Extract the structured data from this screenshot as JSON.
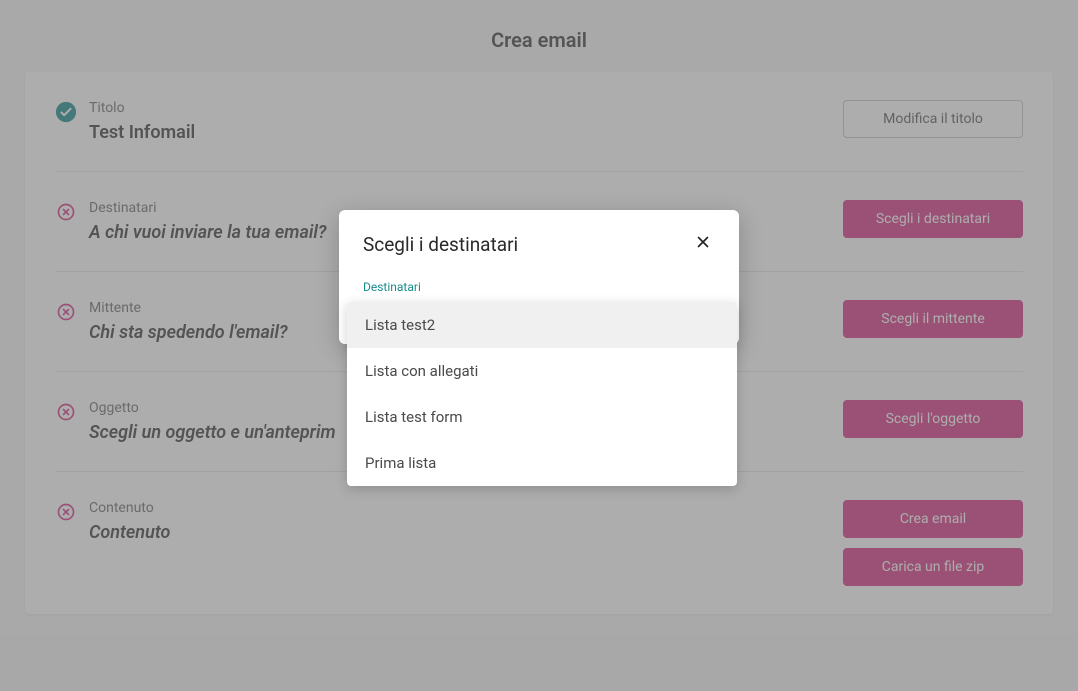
{
  "page": {
    "title": "Crea email"
  },
  "sections": {
    "titolo": {
      "label": "Titolo",
      "value": "Test Infomail",
      "action": "Modifica il titolo",
      "status": "complete"
    },
    "destinatari": {
      "label": "Destinatari",
      "value": "A chi vuoi inviare la tua email?",
      "action": "Scegli i destinatari",
      "status": "incomplete"
    },
    "mittente": {
      "label": "Mittente",
      "value": "Chi sta spedendo l'email?",
      "action": "Scegli il mittente",
      "status": "incomplete"
    },
    "oggetto": {
      "label": "Oggetto",
      "value": "Scegli un oggetto e un'anteprim",
      "action": "Scegli l'oggetto",
      "status": "incomplete"
    },
    "contenuto": {
      "label": "Contenuto",
      "value": "Contenuto",
      "action1": "Crea email",
      "action2": "Carica un file zip",
      "status": "incomplete"
    }
  },
  "modal": {
    "title": "Scegli i destinatari",
    "field_label": "Destinatari",
    "options": [
      "Lista test2",
      "Lista con allegati",
      "Lista test form",
      "Prima lista"
    ]
  }
}
